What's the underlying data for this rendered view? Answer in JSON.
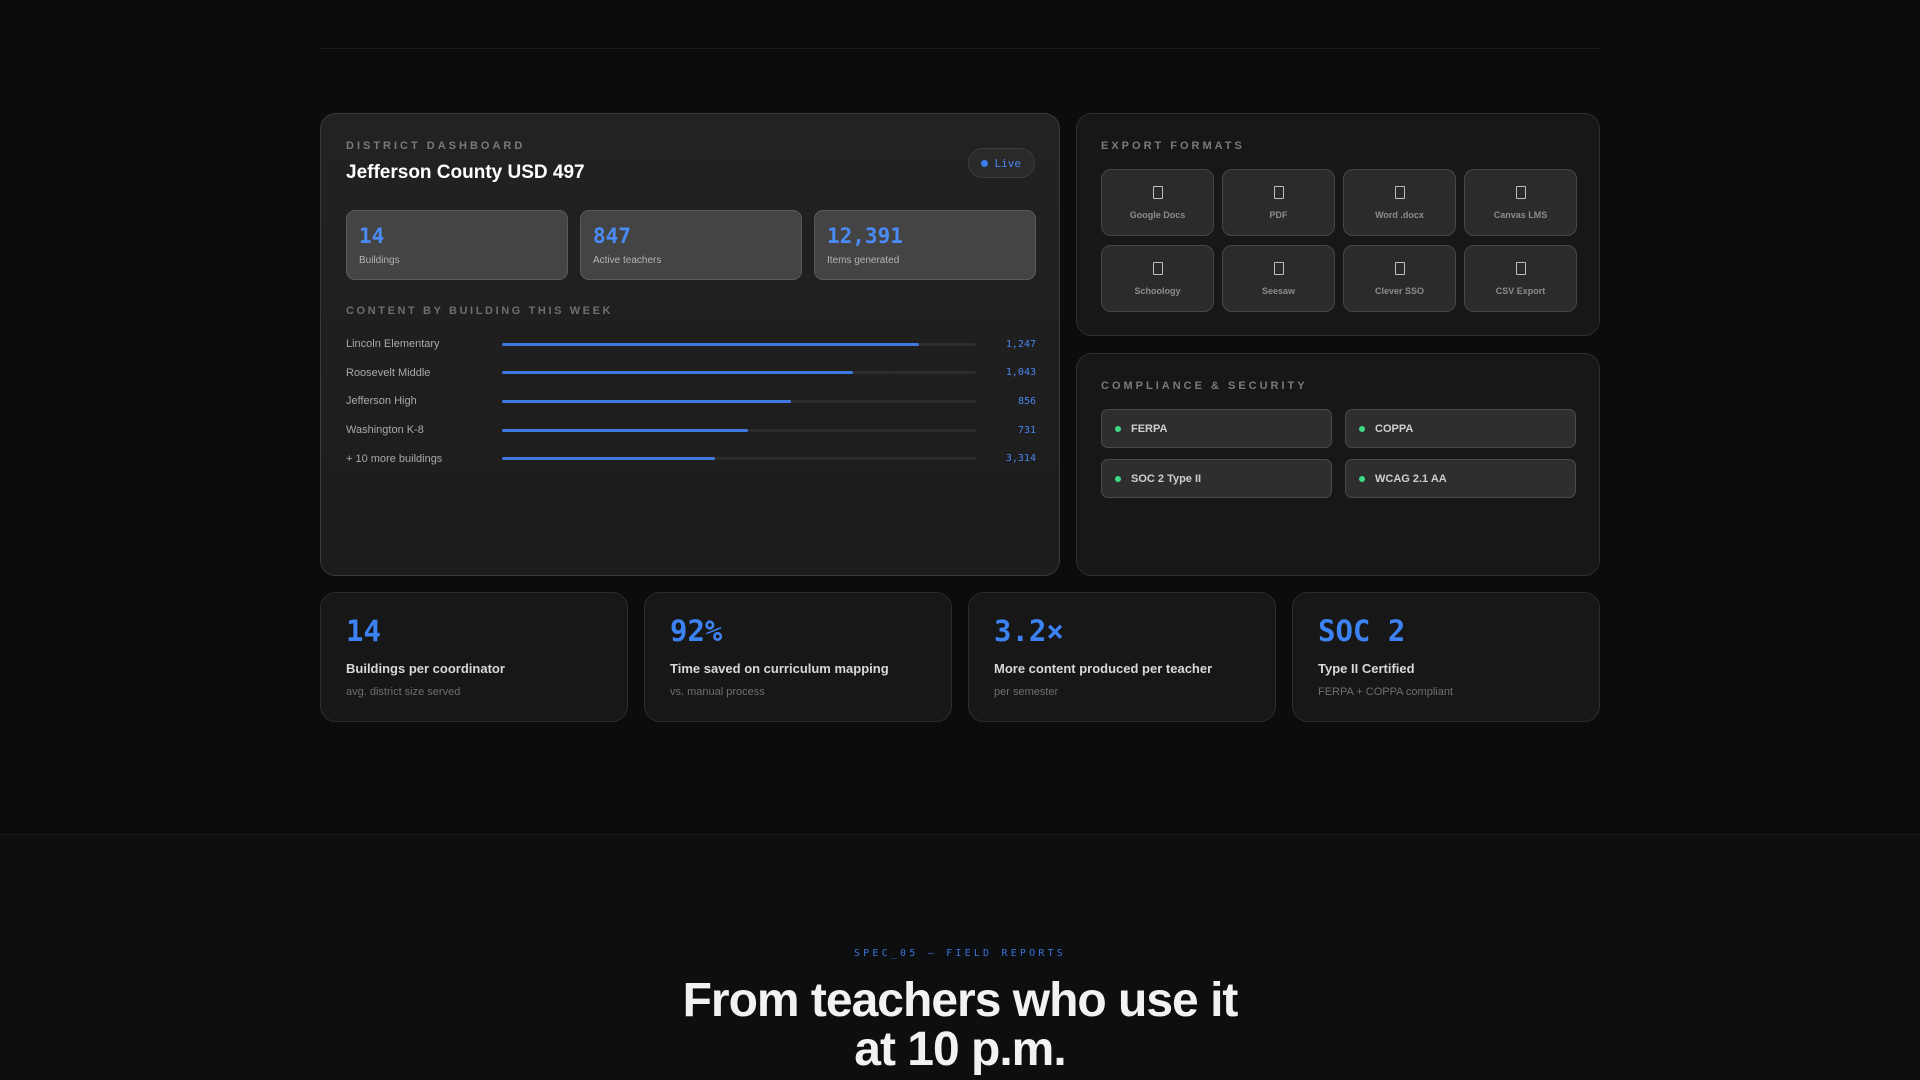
{
  "dashboard": {
    "eyebrow": "DISTRICT DASHBOARD",
    "title": "Jefferson County USD 497",
    "live_label": "Live",
    "stats": [
      {
        "value": "14",
        "label": "Buildings"
      },
      {
        "value": "847",
        "label": "Active teachers"
      },
      {
        "value": "12,391",
        "label": "Items generated"
      }
    ],
    "bars_eyebrow": "CONTENT BY BUILDING THIS WEEK",
    "buildings": [
      {
        "name": "Lincoln Elementary",
        "count": "1,247",
        "fill": 0.88
      },
      {
        "name": "Roosevelt Middle",
        "count": "1,043",
        "fill": 0.74
      },
      {
        "name": "Jefferson High",
        "count": "856",
        "fill": 0.61
      },
      {
        "name": "Washington K-8",
        "count": "731",
        "fill": 0.52
      },
      {
        "name": "+ 10 more buildings",
        "count": "3,314",
        "fill": 0.45
      }
    ]
  },
  "exports": {
    "eyebrow": "EXPORT FORMATS",
    "formats": [
      {
        "label": "Google Docs",
        "icon": "document-icon"
      },
      {
        "label": "PDF",
        "icon": "document-icon"
      },
      {
        "label": "Word .docx",
        "icon": "document-icon"
      },
      {
        "label": "Canvas LMS",
        "icon": "document-icon"
      },
      {
        "label": "Schoology",
        "icon": "document-icon"
      },
      {
        "label": "Seesaw",
        "icon": "document-icon"
      },
      {
        "label": "Clever SSO",
        "icon": "document-icon"
      },
      {
        "label": "CSV Export",
        "icon": "document-icon"
      }
    ]
  },
  "compliance": {
    "eyebrow": "COMPLIANCE & SECURITY",
    "badges": [
      "FERPA",
      "COPPA",
      "SOC 2 Type II",
      "WCAG 2.1 AA"
    ]
  },
  "metrics": [
    {
      "value": "14",
      "title": "Buildings per coordinator",
      "sub": "avg. district size served"
    },
    {
      "value": "92%",
      "title": "Time saved on curriculum mapping",
      "sub": "vs. manual process"
    },
    {
      "value": "3.2×",
      "title": "More content produced per teacher",
      "sub": "per semester"
    },
    {
      "value": "SOC 2",
      "title": "Type II Certified",
      "sub": "FERPA + COPPA compliant"
    }
  ],
  "field_reports": {
    "eyebrow": "SPEC_05 — FIELD REPORTS",
    "headline_line1": "From teachers who use it",
    "headline_line2": "at 10 p.m."
  },
  "colors": {
    "accent": "#3d82f3",
    "status_ok": "#3ddc84",
    "background": "#0c0c0c"
  }
}
